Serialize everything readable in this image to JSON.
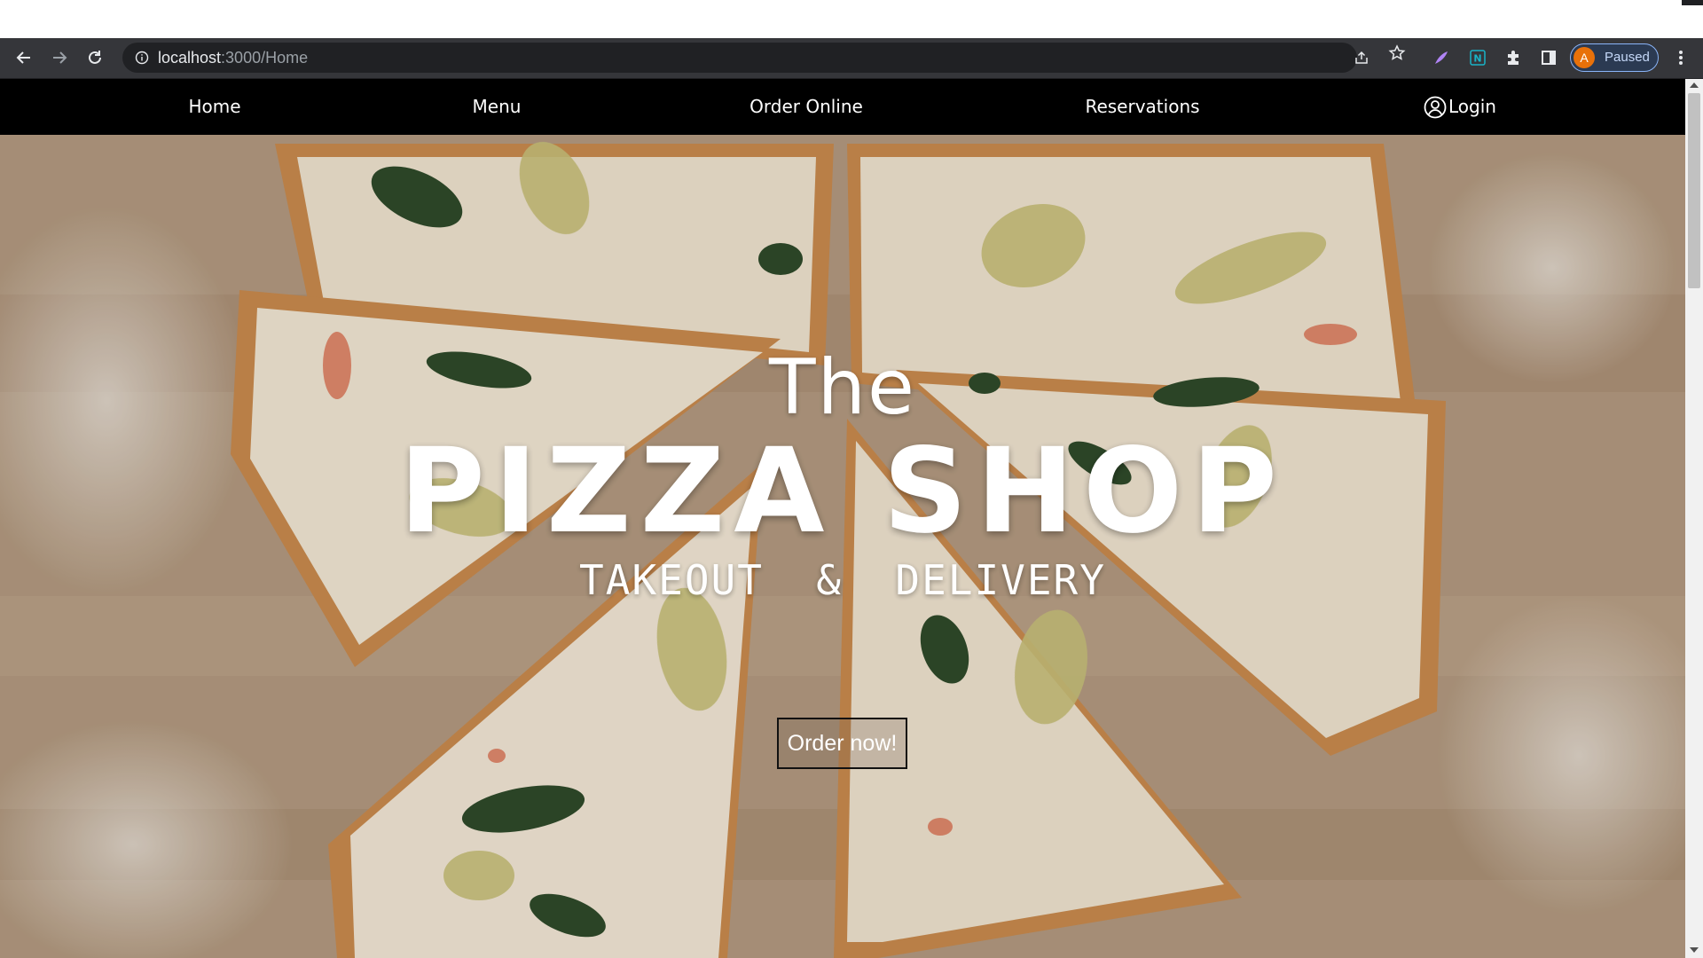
{
  "browser": {
    "url_host": "localhost",
    "url_rest": ":3000/Home",
    "profile_initial": "A",
    "profile_status": "Paused",
    "icons": {
      "back": "back-arrow-icon",
      "forward": "forward-arrow-icon",
      "reload": "reload-icon",
      "site_info": "info-icon",
      "share": "share-icon",
      "bookmark": "star-icon",
      "extension_1": "feather-extension-icon",
      "extension_2": "n-extension-icon",
      "extensions": "puzzle-icon",
      "side_panel": "side-panel-icon",
      "menu": "more-vert-icon"
    }
  },
  "nav": {
    "home": "Home",
    "menu": "Menu",
    "order_online": "Order Online",
    "reservations": "Reservations",
    "login": "Login",
    "login_icon": "user-circle-icon"
  },
  "hero": {
    "the": "The",
    "title": "PIZZA SHOP",
    "subtitle": "TAKEOUT  &  DELIVERY",
    "cta": "Order now!",
    "background": "pizza-photo"
  },
  "colors": {
    "navbar_bg": "#000000",
    "nav_text": "#ffffff",
    "toolbar_bg": "#35363a",
    "profile_accent": "#8ab4f8",
    "avatar_bg": "#e8710a"
  }
}
